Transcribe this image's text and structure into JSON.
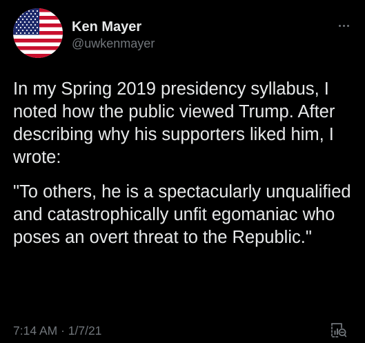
{
  "author": {
    "name": "Ken Mayer",
    "handle": "@uwkenmayer",
    "avatar_icon": "us-flag-avatar"
  },
  "tweet": {
    "paragraphs": [
      "In my Spring 2019 presidency syllabus, I noted how the public viewed Trump.  After describing why his supporters liked him, I wrote:",
      "\"To others, he is a spectacularly unqualified and catastrophically unfit egomaniac who poses an overt threat to the Republic.\""
    ]
  },
  "meta": {
    "timestamp": "7:14 AM · 1/7/21"
  },
  "icons": {
    "more": "more-dots-icon",
    "analytics": "analytics-icon"
  },
  "colors": {
    "background": "#000000",
    "text": "#e7e9ea",
    "secondary": "#71767b"
  }
}
